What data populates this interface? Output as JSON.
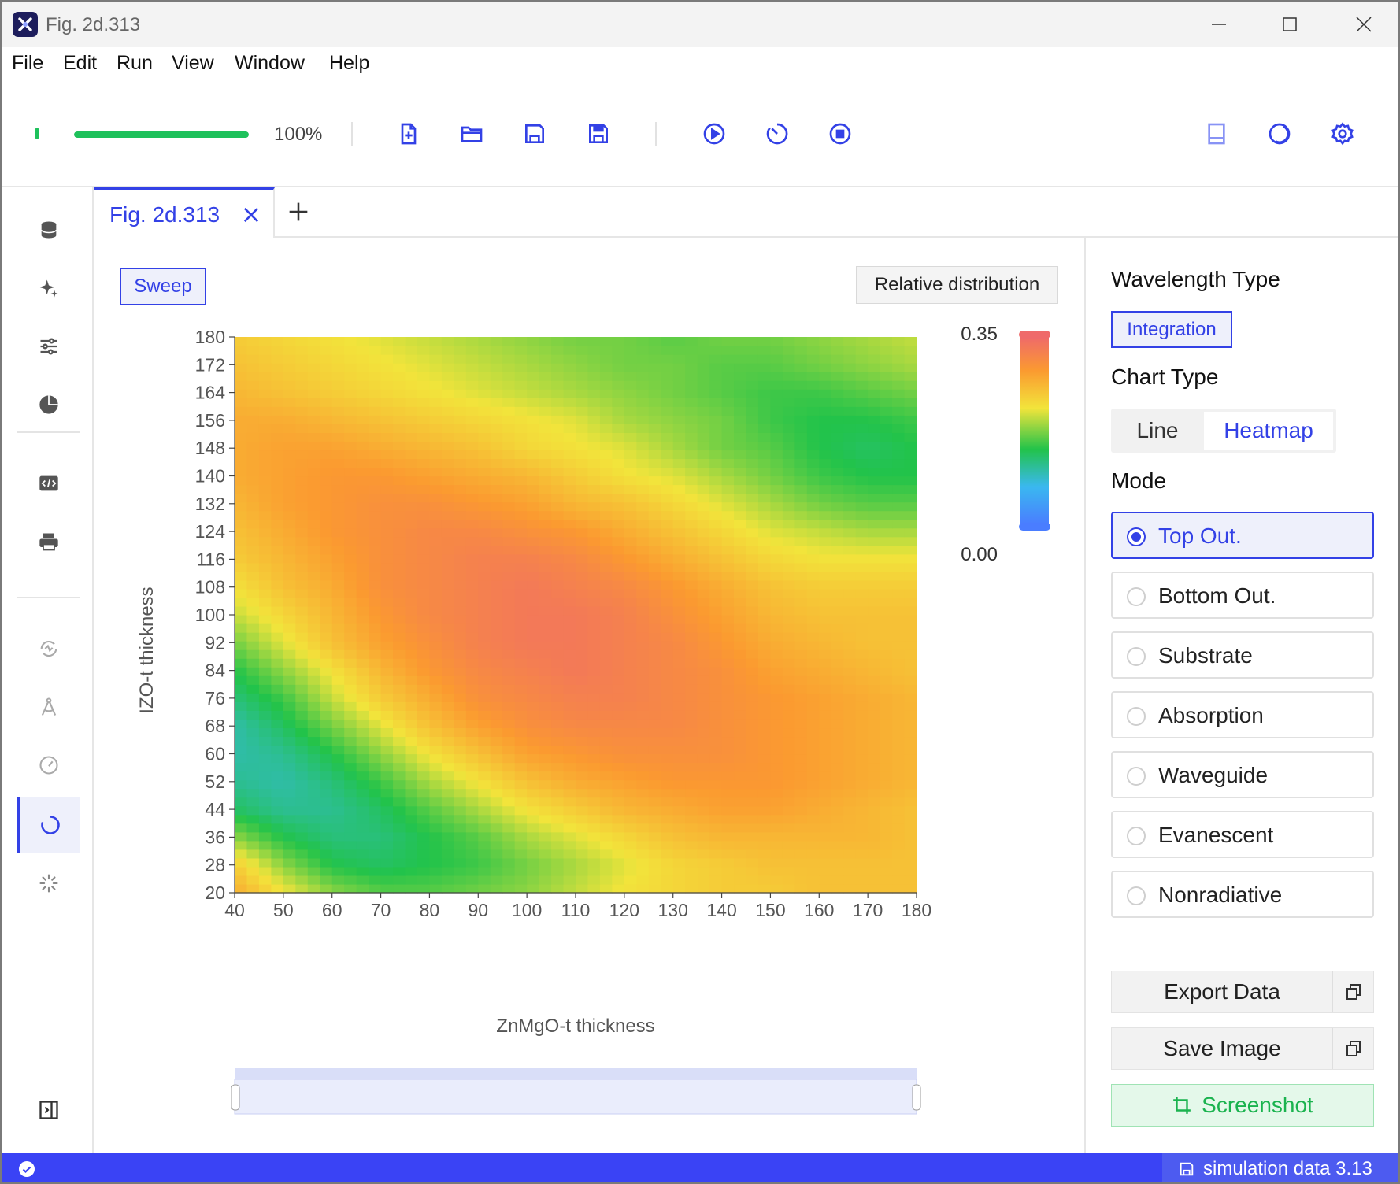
{
  "window": {
    "title": "Fig. 2d.313"
  },
  "menu": [
    "File",
    "Edit",
    "Run",
    "View",
    "Window",
    "Help"
  ],
  "toolbar": {
    "progress": 1.0,
    "progress_text": "100%",
    "file_icons": [
      "new-file-icon",
      "open-folder-icon",
      "save-icon",
      "save-as-icon"
    ],
    "run_icons": [
      "run-icon",
      "timer-icon",
      "stop-icon"
    ],
    "right_icons": [
      "notes-icon",
      "theme-icon",
      "settings-icon"
    ]
  },
  "sidebar": {
    "icons": [
      "database-icon",
      "sparkle-icon",
      "sliders-icon",
      "pie-icon",
      "code-icon",
      "print-icon",
      "pulse-icon",
      "compass-icon",
      "gauge-icon",
      "loader-icon",
      "spinner-icon",
      "collapse-panel-icon"
    ],
    "active": "loader-icon"
  },
  "tabs": {
    "active_label": "Fig. 2d.313"
  },
  "main": {
    "sweep_label": "Sweep",
    "relative_label": "Relative distribution"
  },
  "panel": {
    "wavelength_heading": "Wavelength Type",
    "integration_label": "Integration",
    "chart_type_heading": "Chart Type",
    "chart_type_options": [
      "Line",
      "Heatmap"
    ],
    "chart_type_selected": "Heatmap",
    "mode_heading": "Mode",
    "modes": [
      "Top Out.",
      "Bottom Out.",
      "Substrate",
      "Absorption",
      "Waveguide",
      "Evanescent",
      "Nonradiative"
    ],
    "mode_selected": "Top Out.",
    "export_label": "Export Data",
    "save_image_label": "Save Image",
    "screenshot_label": "Screenshot"
  },
  "statusbar": {
    "label": "simulation data 3.13"
  },
  "colors": {
    "accent": "#3341e6",
    "success": "#1ec15b",
    "statusbar": "#3a43f5"
  },
  "chart_data": {
    "type": "heatmap",
    "xlabel": "ZnMgO-t thickness",
    "ylabel": "IZO-t thickness",
    "x_range": [
      40,
      180
    ],
    "y_range": [
      20,
      180
    ],
    "x_ticks": [
      40,
      50,
      60,
      70,
      80,
      90,
      100,
      110,
      120,
      130,
      140,
      150,
      160,
      170,
      180
    ],
    "y_ticks": [
      20,
      28,
      36,
      44,
      52,
      60,
      68,
      76,
      84,
      92,
      100,
      108,
      116,
      124,
      132,
      140,
      148,
      156,
      164,
      172,
      180
    ],
    "colorbar": {
      "min": 0.0,
      "max": 0.35,
      "min_label": "0.00",
      "max_label": "0.35"
    },
    "x": [
      40,
      50,
      60,
      70,
      80,
      90,
      100,
      110,
      120,
      130,
      140,
      150,
      160,
      170,
      180
    ],
    "y": [
      20,
      28,
      36,
      44,
      52,
      60,
      68,
      76,
      84,
      92,
      100,
      108,
      116,
      124,
      132,
      140,
      148,
      156,
      164,
      172,
      180
    ],
    "z": [
      [
        0.27,
        0.22,
        0.18,
        0.16,
        0.16,
        0.17,
        0.18,
        0.2,
        0.22,
        0.23,
        0.24,
        0.24,
        0.25,
        0.25,
        0.25
      ],
      [
        0.24,
        0.18,
        0.14,
        0.13,
        0.14,
        0.15,
        0.17,
        0.19,
        0.21,
        0.23,
        0.24,
        0.25,
        0.25,
        0.25,
        0.25
      ],
      [
        0.18,
        0.14,
        0.12,
        0.12,
        0.14,
        0.16,
        0.19,
        0.21,
        0.23,
        0.25,
        0.26,
        0.26,
        0.26,
        0.26,
        0.25
      ],
      [
        0.13,
        0.11,
        0.11,
        0.13,
        0.16,
        0.19,
        0.22,
        0.24,
        0.26,
        0.27,
        0.28,
        0.28,
        0.27,
        0.26,
        0.25
      ],
      [
        0.11,
        0.1,
        0.12,
        0.15,
        0.19,
        0.22,
        0.25,
        0.27,
        0.28,
        0.29,
        0.29,
        0.29,
        0.28,
        0.27,
        0.26
      ],
      [
        0.1,
        0.11,
        0.14,
        0.18,
        0.22,
        0.25,
        0.28,
        0.29,
        0.3,
        0.3,
        0.3,
        0.29,
        0.28,
        0.27,
        0.26
      ],
      [
        0.1,
        0.13,
        0.17,
        0.21,
        0.25,
        0.28,
        0.3,
        0.31,
        0.31,
        0.31,
        0.3,
        0.29,
        0.28,
        0.27,
        0.26
      ],
      [
        0.12,
        0.15,
        0.2,
        0.24,
        0.27,
        0.3,
        0.31,
        0.32,
        0.32,
        0.31,
        0.3,
        0.29,
        0.28,
        0.27,
        0.26
      ],
      [
        0.14,
        0.18,
        0.22,
        0.26,
        0.29,
        0.31,
        0.32,
        0.33,
        0.32,
        0.31,
        0.3,
        0.28,
        0.27,
        0.26,
        0.25
      ],
      [
        0.17,
        0.21,
        0.25,
        0.28,
        0.3,
        0.32,
        0.33,
        0.33,
        0.32,
        0.31,
        0.29,
        0.27,
        0.26,
        0.25,
        0.25
      ],
      [
        0.2,
        0.23,
        0.26,
        0.29,
        0.31,
        0.32,
        0.33,
        0.33,
        0.32,
        0.3,
        0.28,
        0.26,
        0.25,
        0.25,
        0.25
      ],
      [
        0.22,
        0.25,
        0.27,
        0.3,
        0.31,
        0.32,
        0.33,
        0.32,
        0.31,
        0.29,
        0.27,
        0.25,
        0.24,
        0.24,
        0.24
      ],
      [
        0.24,
        0.26,
        0.28,
        0.3,
        0.31,
        0.32,
        0.32,
        0.31,
        0.29,
        0.27,
        0.25,
        0.23,
        0.22,
        0.22,
        0.22
      ],
      [
        0.25,
        0.27,
        0.29,
        0.3,
        0.31,
        0.31,
        0.3,
        0.29,
        0.27,
        0.25,
        0.23,
        0.21,
        0.2,
        0.19,
        0.19
      ],
      [
        0.26,
        0.28,
        0.29,
        0.3,
        0.3,
        0.29,
        0.28,
        0.26,
        0.25,
        0.23,
        0.21,
        0.19,
        0.17,
        0.16,
        0.16
      ],
      [
        0.27,
        0.28,
        0.29,
        0.29,
        0.28,
        0.27,
        0.26,
        0.24,
        0.22,
        0.21,
        0.19,
        0.17,
        0.15,
        0.14,
        0.14
      ],
      [
        0.27,
        0.28,
        0.28,
        0.27,
        0.26,
        0.25,
        0.23,
        0.22,
        0.21,
        0.19,
        0.17,
        0.16,
        0.14,
        0.13,
        0.14
      ],
      [
        0.27,
        0.27,
        0.26,
        0.25,
        0.24,
        0.23,
        0.22,
        0.21,
        0.19,
        0.18,
        0.17,
        0.15,
        0.14,
        0.14,
        0.15
      ],
      [
        0.26,
        0.25,
        0.24,
        0.23,
        0.22,
        0.21,
        0.2,
        0.19,
        0.18,
        0.17,
        0.16,
        0.15,
        0.15,
        0.16,
        0.17
      ],
      [
        0.25,
        0.24,
        0.23,
        0.22,
        0.21,
        0.2,
        0.19,
        0.18,
        0.17,
        0.17,
        0.16,
        0.16,
        0.17,
        0.18,
        0.19
      ],
      [
        0.24,
        0.23,
        0.22,
        0.21,
        0.2,
        0.19,
        0.18,
        0.17,
        0.17,
        0.16,
        0.17,
        0.17,
        0.18,
        0.19,
        0.2
      ]
    ]
  }
}
